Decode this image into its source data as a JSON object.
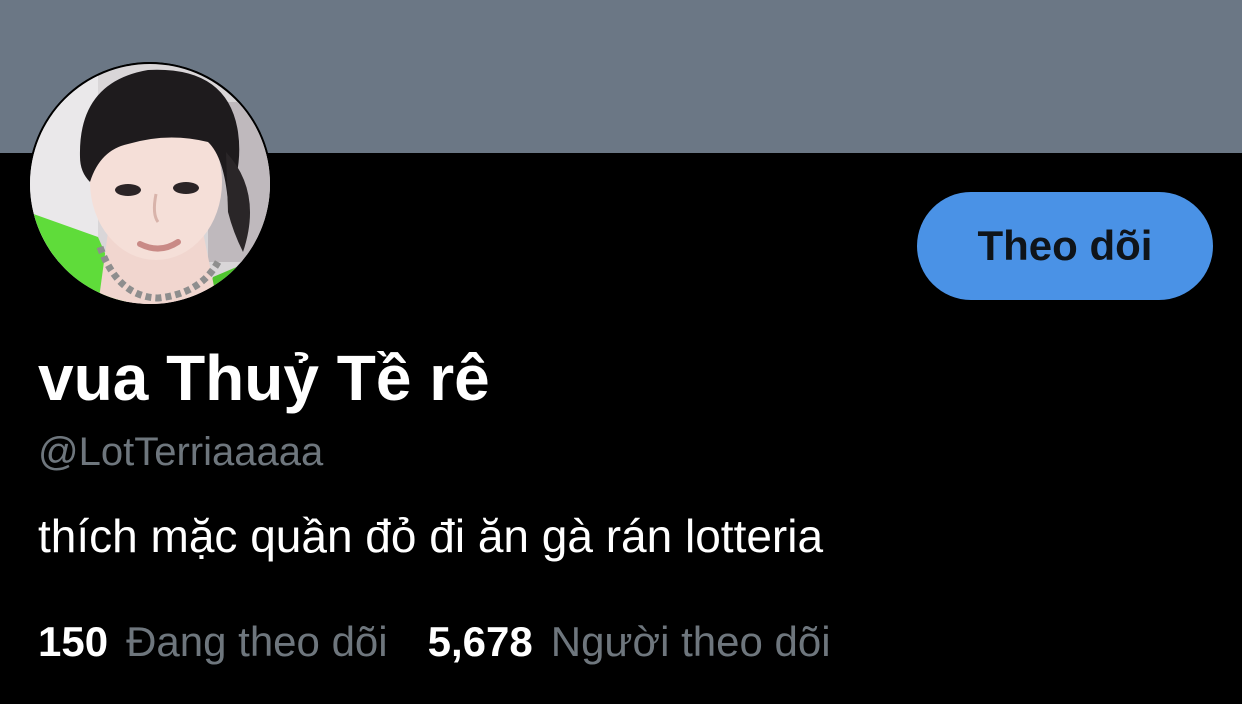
{
  "profile": {
    "display_name": "vua Thuỷ Tề rê",
    "handle": "@LotTerriaaaaa",
    "bio": "thích mặc quần đỏ đi ăn gà rán lotteria",
    "follow_button_label": "Theo dõi"
  },
  "stats": {
    "following": {
      "count": "150",
      "label": "Đang theo dõi"
    },
    "followers": {
      "count": "5,678",
      "label": "Người theo dõi"
    }
  },
  "colors": {
    "banner": "#6b7785",
    "background": "#000000",
    "accent": "#4a92e6",
    "secondary_text": "#6e767d"
  }
}
